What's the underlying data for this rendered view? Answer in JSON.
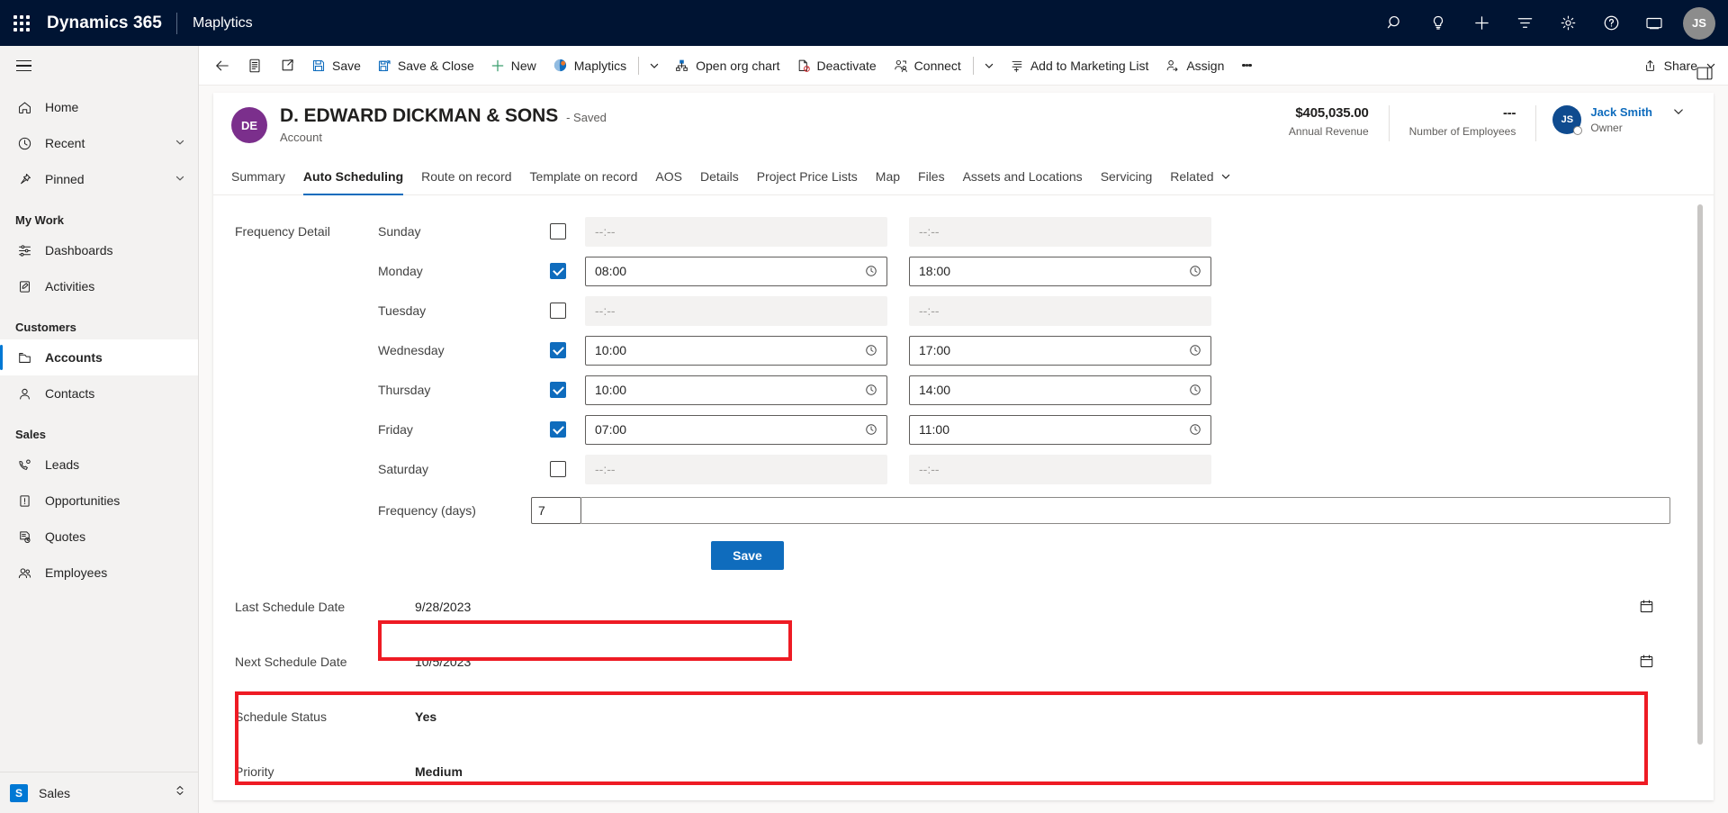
{
  "suite": {
    "waffle_label": "App launcher",
    "brand": "Dynamics 365",
    "app_name": "Maplytics",
    "icons": [
      "search-icon",
      "lightbulb-icon",
      "plus-icon",
      "filter-icon",
      "gear-icon",
      "question-icon",
      "present-icon"
    ],
    "avatar_initials": "JS"
  },
  "sidebar": {
    "hamburger_label": "Expand navigation",
    "items": [
      {
        "label": "Home",
        "icon": "home-icon",
        "type": "item",
        "selected": false,
        "chevron": false
      },
      {
        "label": "Recent",
        "icon": "clock-icon",
        "type": "item",
        "selected": false,
        "chevron": true
      },
      {
        "label": "Pinned",
        "icon": "pin-icon",
        "type": "item",
        "selected": false,
        "chevron": true
      },
      {
        "label": "My Work",
        "type": "group"
      },
      {
        "label": "Dashboards",
        "icon": "dashboard-icon",
        "type": "item",
        "selected": false,
        "chevron": false
      },
      {
        "label": "Activities",
        "icon": "activities-icon",
        "type": "item",
        "selected": false,
        "chevron": false
      },
      {
        "label": "Customers",
        "type": "group"
      },
      {
        "label": "Accounts",
        "icon": "accounts-icon",
        "type": "item",
        "selected": true,
        "chevron": false
      },
      {
        "label": "Contacts",
        "icon": "contacts-icon",
        "type": "item",
        "selected": false,
        "chevron": false
      },
      {
        "label": "Sales",
        "type": "group"
      },
      {
        "label": "Leads",
        "icon": "leads-icon",
        "type": "item",
        "selected": false,
        "chevron": false
      },
      {
        "label": "Opportunities",
        "icon": "opportunities-icon",
        "type": "item",
        "selected": false,
        "chevron": false
      },
      {
        "label": "Quotes",
        "icon": "quotes-icon",
        "type": "item",
        "selected": false,
        "chevron": false
      },
      {
        "label": "Employees",
        "icon": "employees-icon",
        "type": "item",
        "selected": false,
        "chevron": false
      }
    ],
    "area_switcher": {
      "badge": "S",
      "label": "Sales"
    }
  },
  "commandbar": {
    "back_label": "Go back",
    "form_selector_label": "Form selector",
    "popout_label": "Open in new window",
    "save_label": "Save",
    "save_close_label": "Save & Close",
    "new_label": "New",
    "maplytics_label": "Maplytics",
    "open_org_chart_label": "Open org chart",
    "deactivate_label": "Deactivate",
    "connect_label": "Connect",
    "add_to_marketing_list_label": "Add to Marketing List",
    "assign_label": "Assign",
    "overflow_label": "More commands",
    "share_label": "Share"
  },
  "record": {
    "avatar_initials": "DE",
    "title": "D. EDWARD DICKMAN & SONS",
    "saved_status": "- Saved",
    "subtitle": "Account",
    "stats": [
      {
        "value": "$405,035.00",
        "label": "Annual Revenue"
      },
      {
        "value": "---",
        "label": "Number of Employees"
      }
    ],
    "owner": {
      "initials": "JS",
      "name": "Jack Smith",
      "role": "Owner"
    }
  },
  "tabs": [
    {
      "label": "Summary",
      "active": false
    },
    {
      "label": "Auto Scheduling",
      "active": true
    },
    {
      "label": "Route on record",
      "active": false
    },
    {
      "label": "Template on record",
      "active": false
    },
    {
      "label": "AOS",
      "active": false
    },
    {
      "label": "Details",
      "active": false
    },
    {
      "label": "Project Price Lists",
      "active": false
    },
    {
      "label": "Map",
      "active": false
    },
    {
      "label": "Files",
      "active": false
    },
    {
      "label": "Assets and Locations",
      "active": false
    },
    {
      "label": "Servicing",
      "active": false
    },
    {
      "label": "Related",
      "active": false,
      "chevron": true
    }
  ],
  "form": {
    "frequency_detail_label": "Frequency Detail",
    "time_placeholder": "--:--",
    "days": [
      {
        "name": "Sunday",
        "checked": false,
        "start": "",
        "end": ""
      },
      {
        "name": "Monday",
        "checked": true,
        "start": "08:00",
        "end": "18:00"
      },
      {
        "name": "Tuesday",
        "checked": false,
        "start": "",
        "end": ""
      },
      {
        "name": "Wednesday",
        "checked": true,
        "start": "10:00",
        "end": "17:00"
      },
      {
        "name": "Thursday",
        "checked": true,
        "start": "10:00",
        "end": "14:00"
      },
      {
        "name": "Friday",
        "checked": true,
        "start": "07:00",
        "end": "11:00"
      },
      {
        "name": "Saturday",
        "checked": false,
        "start": "",
        "end": ""
      }
    ],
    "frequency_days_label": "Frequency (days)",
    "frequency_days_value": "7",
    "save_button_label": "Save",
    "fields": [
      {
        "label": "Last Schedule Date",
        "value": "9/28/2023",
        "calendar": true,
        "bold": false
      },
      {
        "label": "Next Schedule Date",
        "value": "10/5/2023",
        "calendar": true,
        "bold": false
      },
      {
        "label": "Schedule Status",
        "value": "Yes",
        "calendar": false,
        "bold": true
      },
      {
        "label": "Priority",
        "value": "Medium",
        "calendar": false,
        "bold": true
      }
    ]
  },
  "annotations": {
    "highlight_color": "#ee1b24",
    "boxes": [
      "frequency-days-highlight",
      "schedule-dates-highlight"
    ]
  },
  "colors": {
    "suite_bar": "#001433",
    "accent": "#0f6cbd",
    "sidebar_bg": "#f3f2f1",
    "record_avatar": "#7b2f8c",
    "highlight": "#ee1b24"
  }
}
